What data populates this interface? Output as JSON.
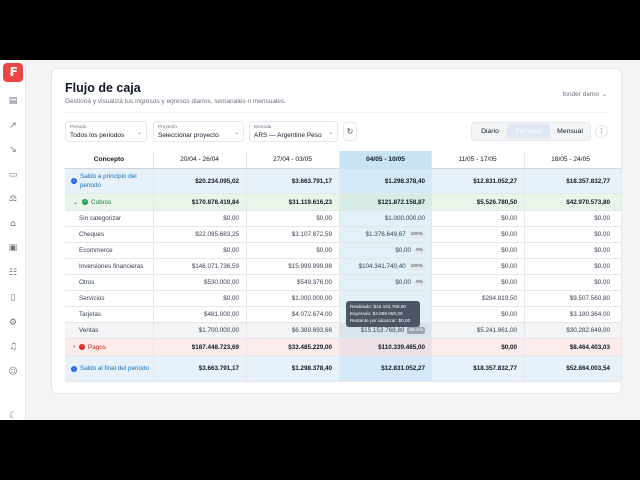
{
  "page": {
    "title": "Flujo de caja",
    "subtitle": "Gestioná y visualizá tus ingresos y egresos diarios, semanales o mensuales.",
    "user": "fonder demo"
  },
  "filters": {
    "periodo": {
      "label": "Periodo",
      "value": "Todos los periodos"
    },
    "proyecto": {
      "label": "Proyecto",
      "value": "Seleccionar proyecto"
    },
    "moneda": {
      "label": "Moneda",
      "value": "ARS — Argentine Peso"
    }
  },
  "view_toggle": {
    "options": [
      "Diario",
      "Semanal",
      "Mensual"
    ],
    "selected": "Semanal"
  },
  "table": {
    "concept_header": "Concepto",
    "columns": [
      "20/04 - 26/04",
      "27/04 - 03/05",
      "04/05 - 10/05",
      "11/05 - 17/05",
      "18/05 - 24/05"
    ],
    "highlighted_column": "04/05 - 10/05",
    "rows": {
      "saldo_inicio": {
        "label": "Saldo a principio del periodo",
        "values": [
          "$20.234.095,02",
          "$3.663.791,17",
          "$1.298.378,40",
          "$12.831.052,27",
          "$18.357.832,77"
        ]
      },
      "cobros": {
        "label": "Cobros",
        "values": [
          "$170.878.419,84",
          "$31.119.616,23",
          "$121.872.158,87",
          "$5.526.780,50",
          "$42.970.573,80"
        ]
      },
      "sin_categorizar": {
        "label": "Sin categorizar",
        "values": [
          "$0,00",
          "$0,00",
          "$1.000.000,00",
          "$0,00",
          "$0,00"
        ]
      },
      "cheques": {
        "label": "Cheques",
        "values": [
          "$22.095.683,25",
          "$3.107.872,59",
          "$1.376.649,67",
          "$0,00",
          "$0,00"
        ],
        "badge": "100%"
      },
      "ecommerce": {
        "label": "Ecommerce",
        "values": [
          "$0,00",
          "$0,00",
          "$0,00",
          "$0,00",
          "$0,00"
        ],
        "badge": "0%"
      },
      "inversiones": {
        "label": "Inversiones financieras",
        "values": [
          "$146.071.736,59",
          "$15.999.999,98",
          "$104.341.740,40",
          "$0,00",
          "$0,00"
        ],
        "badge": "100%"
      },
      "otros": {
        "label": "Otros",
        "values": [
          "$530.000,00",
          "$549.376,00",
          "$0,00",
          "$0,00",
          "$0,00"
        ],
        "badge": "0%"
      },
      "servicios": {
        "label": "Servicios",
        "values": [
          "$0,00",
          "$1.000.000,00",
          "",
          "$284.819,50",
          "$9.507.560,80"
        ]
      },
      "tarjetas": {
        "label": "Tarjetas",
        "values": [
          "$481.000,00",
          "$4.072.674,00",
          "",
          "$0,00",
          "$3.180.364,00"
        ]
      },
      "ventas": {
        "label": "Ventas",
        "values": [
          "$1.700.000,00",
          "$6.389.693,66",
          "$15.153.768,80",
          "$5.241.961,00",
          "$30.282.649,00"
        ],
        "badge": "66.4%"
      },
      "pagos": {
        "label": "Pagos",
        "values": [
          "$187.448.723,69",
          "$33.485.229,00",
          "$110.339.485,00",
          "$0,00",
          "$8.464.403,03"
        ]
      },
      "saldo_final": {
        "label": "Saldo al final del periodo",
        "values": [
          "$3.663.791,17",
          "$1.298.378,40",
          "$12.831.052,27",
          "$18.357.832,77",
          "$52.864.003,54"
        ]
      }
    }
  },
  "tooltip": {
    "realizado": "Realizado: $15.153.768,80",
    "esperado": "Esperado: $2.685.050,00",
    "restante": "Restante por alcanzar: $0,00"
  },
  "colors": {
    "brand": "#ef4444",
    "highlight": "#e2f0f8",
    "cobros_bg": "#eaf5ea",
    "pagos_bg": "#fdecec",
    "saldo_bg": "#e6f1fa"
  },
  "icons": [
    "logo-icon",
    "dashboard-icon",
    "trend-up-icon",
    "trend-down-icon",
    "document-icon",
    "scale-icon",
    "bank-icon",
    "briefcase-icon",
    "users-icon",
    "file-icon",
    "settings-icon",
    "bell-icon",
    "user-icon",
    "moon-icon",
    "refresh-icon",
    "more-icon"
  ]
}
